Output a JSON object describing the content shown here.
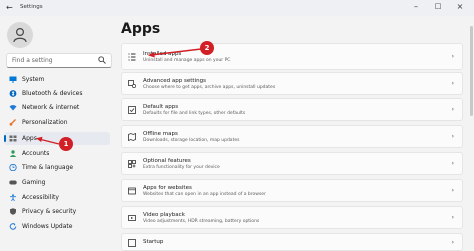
{
  "window": {
    "title": "Settings"
  },
  "search": {
    "placeholder": "Find a setting"
  },
  "sidebar": {
    "items": [
      {
        "label": "System",
        "icon": "monitor-icon",
        "color": "#0078d4"
      },
      {
        "label": "Bluetooth & devices",
        "icon": "bluetooth-icon",
        "color": "#0067c0"
      },
      {
        "label": "Network & internet",
        "icon": "wifi-icon",
        "color": "#1f7bd6"
      },
      {
        "label": "Personalization",
        "icon": "brush-icon",
        "color": "#e8742a"
      },
      {
        "label": "Apps",
        "icon": "apps-grid-icon",
        "color": "#6b6b6b",
        "active": true
      },
      {
        "label": "Accounts",
        "icon": "person-icon",
        "color": "#2e9d5c"
      },
      {
        "label": "Time & language",
        "icon": "globe-clock-icon",
        "color": "#1f7bd6"
      },
      {
        "label": "Gaming",
        "icon": "controller-icon",
        "color": "#555555"
      },
      {
        "label": "Accessibility",
        "icon": "accessibility-icon",
        "color": "#1f7bd6"
      },
      {
        "label": "Privacy & security",
        "icon": "shield-icon",
        "color": "#555555"
      },
      {
        "label": "Windows Update",
        "icon": "refresh-icon",
        "color": "#1f7bd6"
      }
    ]
  },
  "main": {
    "title": "Apps",
    "cards": [
      {
        "title": "Installed apps",
        "subtitle": "Uninstall and manage apps on your PC",
        "icon": "list-icon"
      },
      {
        "title": "Advanced app settings",
        "subtitle": "Choose where to get apps, archive apps, uninstall updates",
        "icon": "app-settings-icon"
      },
      {
        "title": "Default apps",
        "subtitle": "Defaults for file and link types, other defaults",
        "icon": "default-apps-icon"
      },
      {
        "title": "Offline maps",
        "subtitle": "Downloads, storage location, map updates",
        "icon": "map-icon"
      },
      {
        "title": "Optional features",
        "subtitle": "Extra functionality for your device",
        "icon": "features-icon"
      },
      {
        "title": "Apps for websites",
        "subtitle": "Websites that can open in an app instead of a browser",
        "icon": "web-apps-icon"
      },
      {
        "title": "Video playback",
        "subtitle": "Video adjustments, HDR streaming, battery options",
        "icon": "video-icon"
      },
      {
        "title": "Startup",
        "subtitle": "",
        "icon": "startup-icon"
      }
    ]
  },
  "annotations": {
    "badge_1": "1",
    "badge_2": "2",
    "color": "#d21f26"
  }
}
